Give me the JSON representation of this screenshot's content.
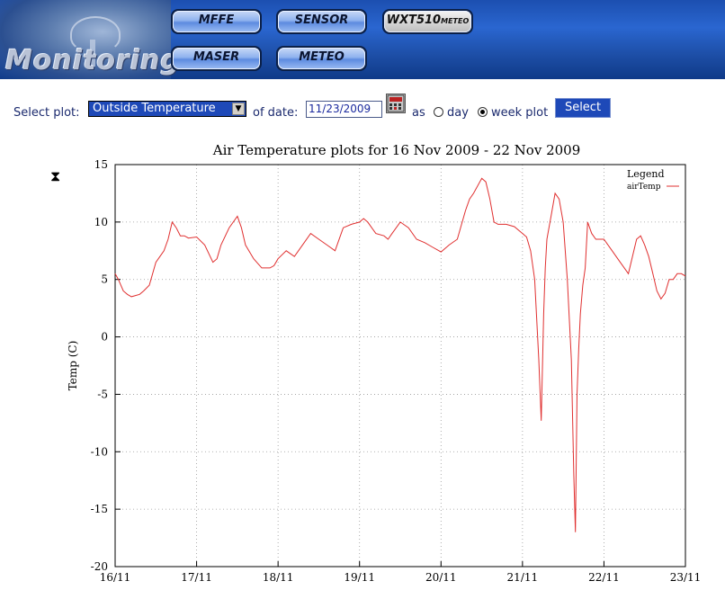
{
  "header": {
    "title": "Monitoring :",
    "nav": [
      {
        "label": "MFFE",
        "style": "blue"
      },
      {
        "label": "SENSOR",
        "style": "blue"
      },
      {
        "label": "WXT510",
        "sub": "METEO",
        "style": "dark"
      },
      {
        "label": "MASER",
        "style": "blue"
      },
      {
        "label": "METEO",
        "style": "blue"
      }
    ],
    "colors": {
      "banner": "#1c4fb0",
      "button": "#8fb2ee"
    }
  },
  "controls": {
    "select_plot_label": "Select plot:",
    "plot_selected": "Outside Temperature",
    "of_date_label": "of date:",
    "date_value": "11/23/2009",
    "as_label": "as",
    "day_label": "day",
    "week_label": "week plot",
    "mode_selected": "week plot",
    "select_button": "Select",
    "calendar_icon": "calendar-icon",
    "loading_icon": "hourglass-icon"
  },
  "chart_data": {
    "type": "line",
    "title": "Air Temperature plots for 16 Nov 2009 - 22 Nov 2009",
    "xlabel": "",
    "ylabel": "Temp (C)",
    "ylim": [
      -20,
      15
    ],
    "yticks": [
      -20,
      -15,
      -10,
      -5,
      0,
      5,
      10,
      15
    ],
    "xlim": [
      0,
      7
    ],
    "xticks": [
      "16/11",
      "17/11",
      "18/11",
      "19/11",
      "20/11",
      "21/11",
      "22/11",
      "23/11"
    ],
    "grid": true,
    "legend_title": "Legend",
    "legend_position": "top-right",
    "series": [
      {
        "name": "airTemp",
        "color": "#e03030",
        "x": [
          0,
          0.04,
          0.1,
          0.15,
          0.2,
          0.25,
          0.3,
          0.35,
          0.42,
          0.5,
          0.55,
          0.6,
          0.65,
          0.7,
          0.75,
          0.8,
          0.85,
          0.9,
          1.0,
          1.1,
          1.2,
          1.25,
          1.3,
          1.4,
          1.5,
          1.55,
          1.6,
          1.7,
          1.8,
          1.9,
          1.95,
          2.0,
          2.1,
          2.2,
          2.3,
          2.4,
          2.5,
          2.6,
          2.7,
          2.8,
          2.9,
          3.0,
          3.05,
          3.1,
          3.2,
          3.3,
          3.35,
          3.4,
          3.5,
          3.6,
          3.7,
          3.8,
          3.9,
          4.0,
          4.1,
          4.2,
          4.3,
          4.35,
          4.4,
          4.5,
          4.55,
          4.6,
          4.65,
          4.7,
          4.8,
          4.9,
          5.0,
          5.05,
          5.1,
          5.15,
          5.2,
          5.23,
          5.26,
          5.28,
          5.3,
          5.35,
          5.4,
          5.45,
          5.5,
          5.55,
          5.6,
          5.63,
          5.65,
          5.67,
          5.69,
          5.71,
          5.74,
          5.77,
          5.8,
          5.85,
          5.9,
          6.0,
          6.1,
          6.2,
          6.3,
          6.4,
          6.45,
          6.5,
          6.55,
          6.6,
          6.65,
          6.7,
          6.75,
          6.8,
          6.85,
          6.9,
          6.95,
          7.0
        ],
        "values": [
          5.5,
          5.0,
          4.0,
          3.7,
          3.5,
          3.6,
          3.7,
          4.0,
          4.5,
          6.5,
          7.0,
          7.5,
          8.5,
          10.0,
          9.5,
          8.8,
          8.8,
          8.6,
          8.7,
          8.0,
          6.5,
          6.8,
          8.0,
          9.5,
          10.5,
          9.5,
          8.0,
          6.8,
          6.0,
          6.0,
          6.2,
          6.8,
          7.5,
          7.0,
          8.0,
          9.0,
          8.5,
          8.0,
          7.5,
          9.5,
          9.8,
          10.0,
          10.3,
          10.0,
          9.0,
          8.8,
          8.5,
          9.0,
          10.0,
          9.5,
          8.5,
          8.2,
          7.8,
          7.4,
          8.0,
          8.5,
          11.0,
          12.0,
          12.5,
          13.8,
          13.5,
          12.0,
          10.0,
          9.8,
          9.8,
          9.6,
          9.0,
          8.7,
          7.5,
          5.0,
          -2.0,
          -7.3,
          2.0,
          6.0,
          8.5,
          10.5,
          12.5,
          12.0,
          10.0,
          5.0,
          -2.0,
          -12.0,
          -17.0,
          -5.0,
          -1.0,
          2.0,
          4.5,
          6.0,
          10.0,
          9.0,
          8.5,
          8.5,
          7.5,
          6.5,
          5.5,
          8.5,
          8.8,
          8.0,
          7.0,
          5.5,
          4.0,
          3.3,
          3.8,
          5.0,
          5.0,
          5.5,
          5.5,
          5.3
        ]
      }
    ]
  }
}
